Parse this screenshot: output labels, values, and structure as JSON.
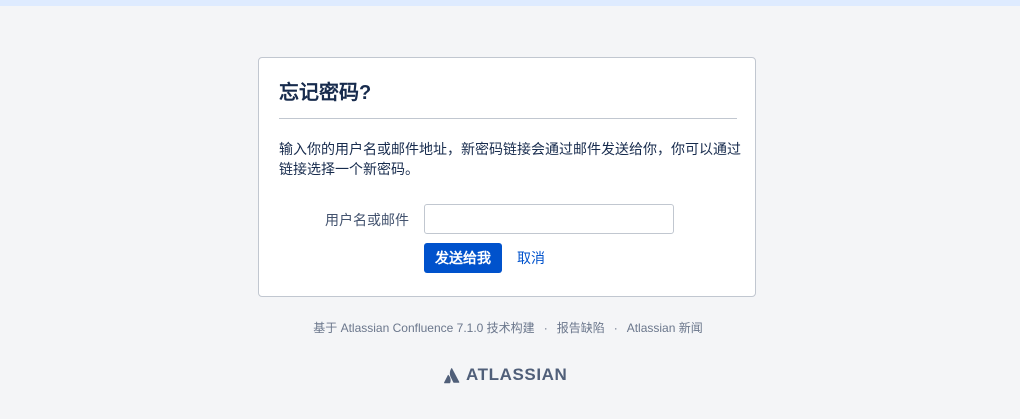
{
  "form": {
    "title": "忘记密码?",
    "description": "输入你的用户名或邮件地址，新密码链接会通过邮件发送给你，你可以通过链接选择一个新密码。",
    "field_label": "用户名或邮件",
    "field_value": "",
    "field_placeholder": "",
    "send_label": "发送给我",
    "cancel_label": "取消"
  },
  "footer": {
    "powered_by": "基于 Atlassian Confluence 7.1.0 技术构建",
    "separator": "·",
    "report_bug": "报告缺陷",
    "news": "Atlassian 新闻",
    "brand": "ATLASSIAN"
  },
  "colors": {
    "primary": "#0052cc",
    "page_background": "#f4f5f7",
    "top_strip": "#deebff",
    "logo": "#505f79"
  },
  "icons": {
    "logo": "atlassian-logo-icon"
  }
}
